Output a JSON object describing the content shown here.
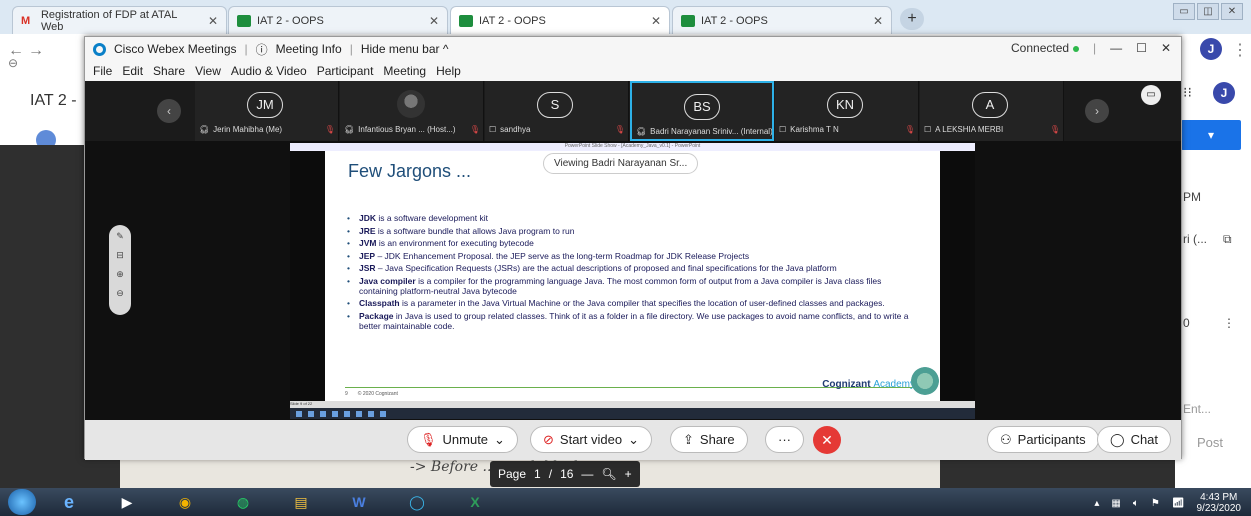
{
  "browser": {
    "tabs": [
      {
        "label": "Registration of FDP at ATAL Web",
        "icon": "gmail-icon"
      },
      {
        "label": "IAT 2 - OOPS",
        "icon": "classroom-icon"
      },
      {
        "label": "IAT 2 - OOPS",
        "icon": "classroom-icon"
      },
      {
        "label": "IAT 2 - OOPS",
        "icon": "classroom-icon"
      }
    ],
    "page_title": "IAT 2 -",
    "user_initial": "J",
    "right_texts": [
      "PM",
      "ri (...",
      "Ent...",
      "Post"
    ],
    "pdf_page_label": "Page",
    "pdf_page": "1",
    "pdf_sep": "/",
    "pdf_total": "16",
    "handwriting": "-> Before ... catch block"
  },
  "webex": {
    "app_name": "Cisco Webex Meetings",
    "meeting_info": "Meeting Info",
    "hide_menu": "Hide menu bar ^",
    "status": "Connected",
    "menu": [
      "File",
      "Edit",
      "Share",
      "View",
      "Audio & Video",
      "Participant",
      "Meeting",
      "Help"
    ],
    "participants": [
      {
        "initials": "JM",
        "name": "Jerin Mahibha (Me)",
        "muted": true
      },
      {
        "initials": "",
        "name": "Infantious Bryan ... (Host...)",
        "muted": true,
        "photo": true
      },
      {
        "initials": "S",
        "name": "sandhya",
        "muted": true
      },
      {
        "initials": "BS",
        "name": "Badri Narayanan Sriniv... (Internal)",
        "muted": false,
        "selected": true
      },
      {
        "initials": "KN",
        "name": "Karishma T N",
        "muted": true
      },
      {
        "initials": "A",
        "name": "A LEKSHIA MERBI",
        "muted": true
      }
    ],
    "viewing": "Viewing Badri Narayanan Sr...",
    "controls": {
      "unmute": "Unmute",
      "start_video": "Start video",
      "share": "Share",
      "more": "···",
      "participants": "Participants",
      "chat": "Chat"
    }
  },
  "slide": {
    "window_title": "PowerPoint Slide Show - [Academy_Java_v0.1] - PowerPoint",
    "title": "Few Jargons ...",
    "bullets": [
      {
        "term": "JDK",
        "text": " is a software development kit"
      },
      {
        "term": "JRE",
        "text": " is a software bundle that allows Java program to run"
      },
      {
        "term": "JVM",
        "text": " is an environment for executing bytecode"
      },
      {
        "term": "JEP",
        "text": " – JDK Enhancement Proposal. the JEP serve as the long-term Roadmap for JDK Release Projects"
      },
      {
        "term": "JSR",
        "text": " – Java Specification Requests (JSRs) are the actual descriptions of proposed and final specifications for the Java platform"
      },
      {
        "term": "Java compiler",
        "text": " is a compiler for the programming language Java. The most common form of output from a Java compiler is Java class files containing platform-neutral Java bytecode"
      },
      {
        "term": "Classpath",
        "text": " is a parameter in the Java Virtual Machine or the Java compiler that specifies the location of user-defined classes and packages."
      },
      {
        "term": "Package",
        "text": " in Java is used to group related classes. Think of it as a folder in a file directory. We use packages to avoid name conflicts, and to write a better maintainable code."
      }
    ],
    "footer_page": "9",
    "footer_copy": "© 2020 Cognizant",
    "brand": "Cognizant",
    "brand_sub": "Academy",
    "status_left": "Slide 9 of 22"
  },
  "taskbar": {
    "time": "4:43 PM",
    "date": "9/23/2020"
  }
}
